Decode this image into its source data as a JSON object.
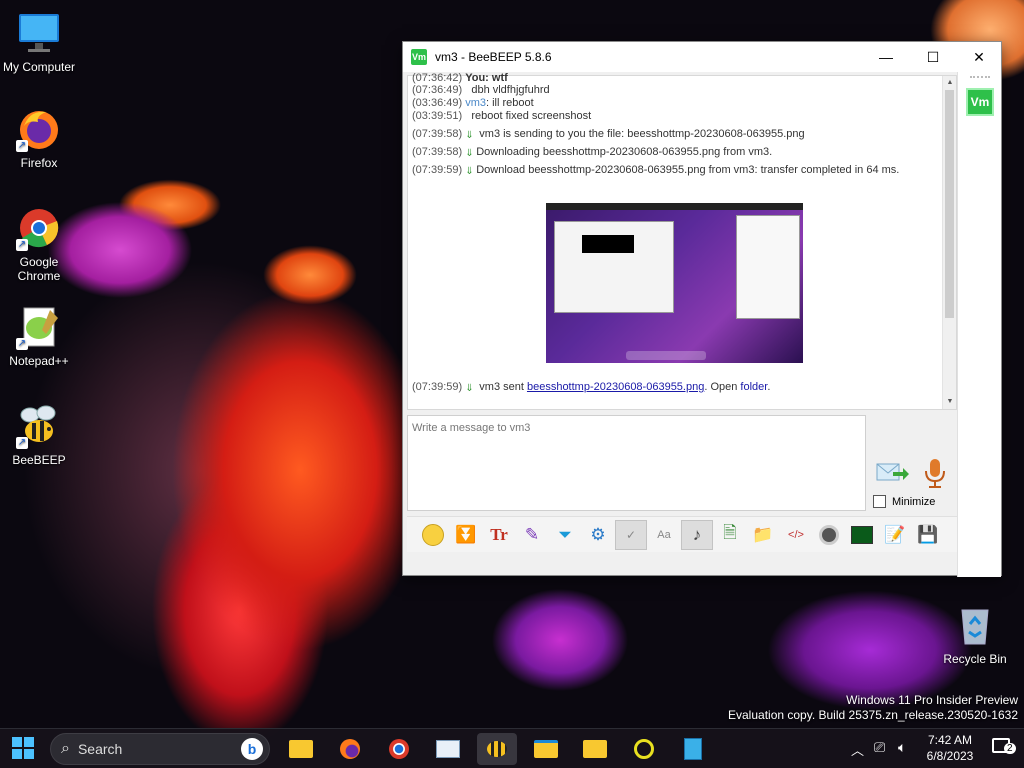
{
  "desktop": {
    "icons": [
      {
        "label": "My Computer"
      },
      {
        "label": "Firefox"
      },
      {
        "label": "Google Chrome"
      },
      {
        "label": "Notepad++"
      },
      {
        "label": "BeeBEEP"
      },
      {
        "label": "Recycle Bin"
      }
    ],
    "watermark": {
      "line1": "Windows 11 Pro Insider Preview",
      "line2": "Evaluation copy. Build 25375.zn_release.230520-1632"
    }
  },
  "window": {
    "icon_text": "Vm",
    "title": "vm3 - BeeBEEP 5.8.6",
    "minimize_glyph": "—",
    "maximize_glyph": "☐",
    "close_glyph": "✕",
    "chat": {
      "l0_ts": "(07:36:42)",
      "l0_text": "You: wtf",
      "l1_ts": "(07:36:49)",
      "l1_text": "dbh vldfhjgfuhrd",
      "l2_ts": "(03:36:49)",
      "l2_user": "vm3",
      "l2_text": ": ill reboot",
      "l3_ts": "(03:39:51)",
      "l3_text": "reboot fixed screenshost",
      "l4_ts": "(07:39:58)",
      "l4_text": "vm3 is sending to you the file: beesshottmp-20230608-063955.png",
      "l5_ts": "(07:39:58)",
      "l5_text": "Downloading beesshottmp-20230608-063955.png from vm3.",
      "l6_ts": "(07:39:59)",
      "l6_text": "Download beesshottmp-20230608-063955.png from vm3: transfer completed in 64 ms.",
      "l7_ts": "(07:39:59)",
      "l7_pre": "vm3 sent ",
      "l7_file": "beesshottmp-20230608-063955.png",
      "l7_mid": ". Open ",
      "l7_folder": "folder",
      "l7_end": "."
    },
    "input_placeholder": "Write a message to vm3",
    "minimize_label": "Minimize",
    "side_badge": "Vm"
  },
  "taskbar": {
    "search_placeholder": "Search",
    "time": "7:42 AM",
    "date": "6/8/2023",
    "notif_count": "2"
  }
}
